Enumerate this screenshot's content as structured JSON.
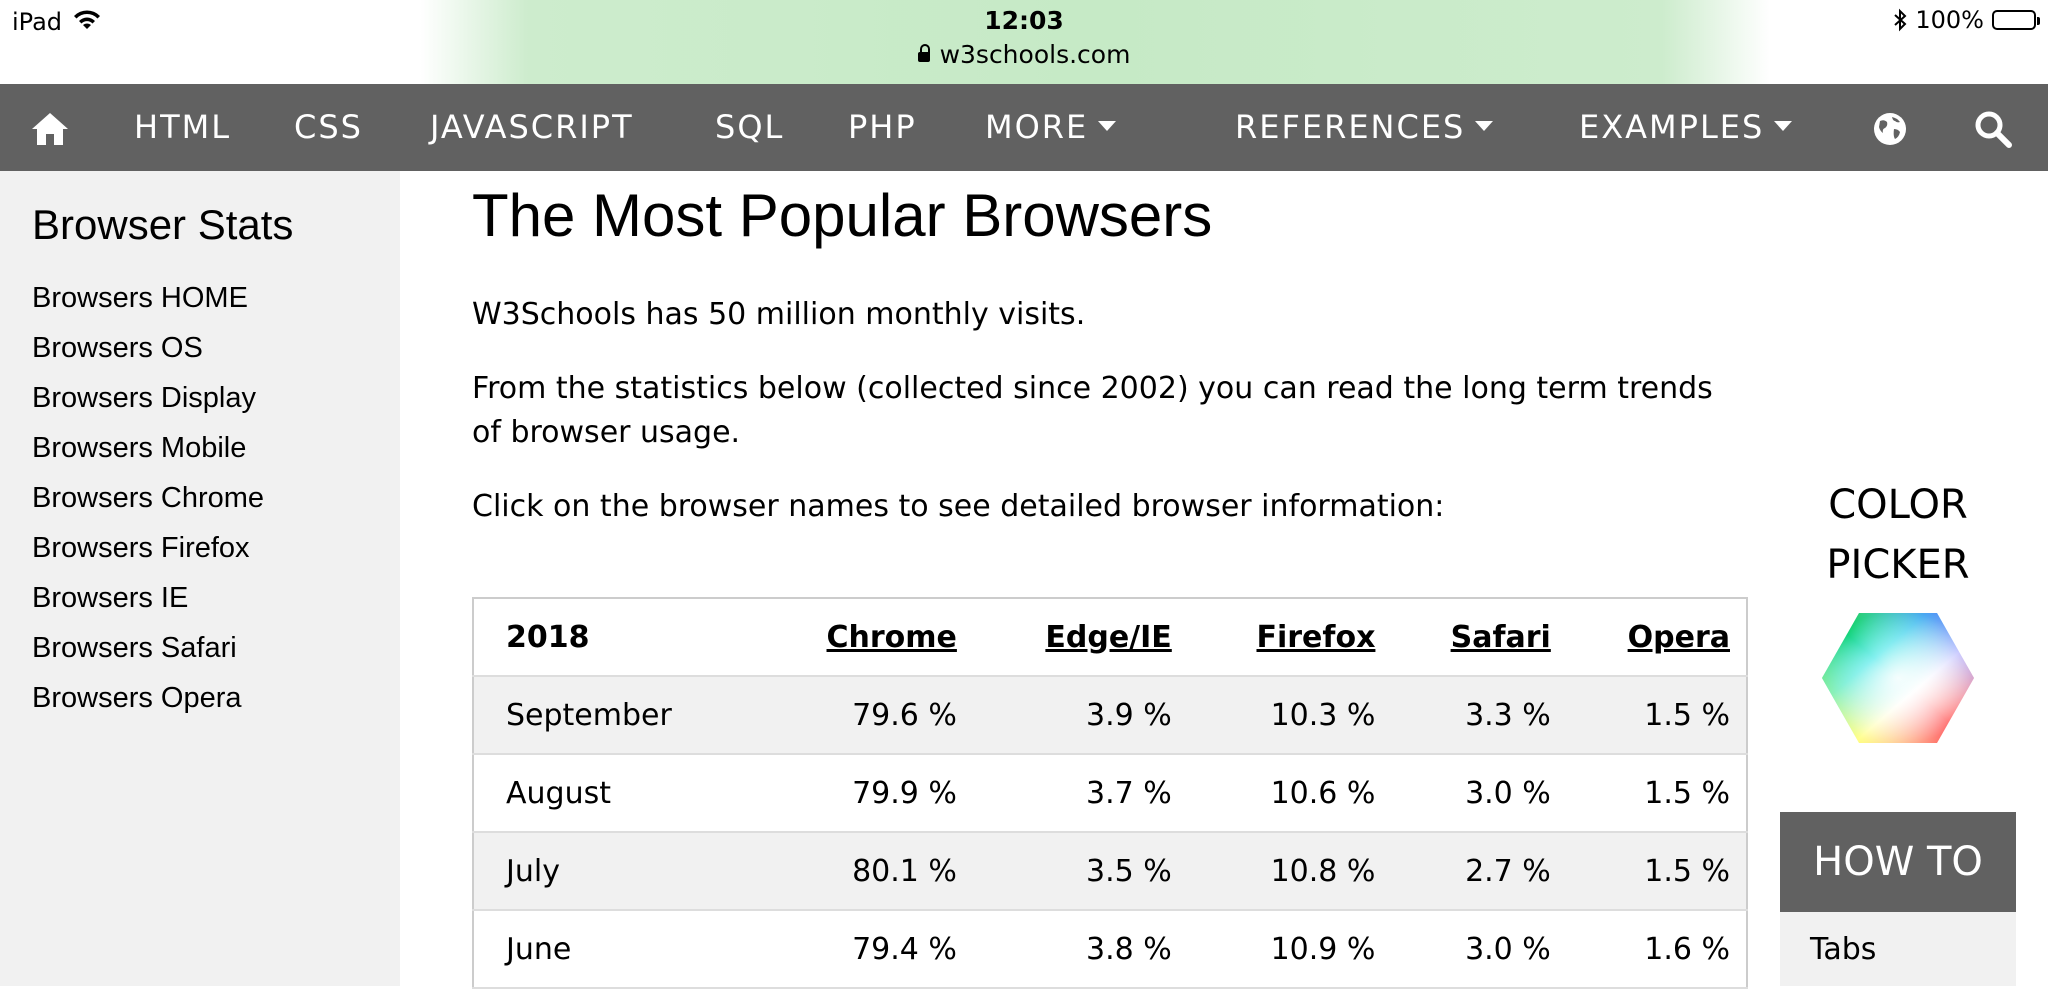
{
  "status_bar": {
    "device": "iPad",
    "time": "12:03",
    "url": "w3schools.com",
    "battery": "100%"
  },
  "nav": {
    "home_icon": "home-icon",
    "items": [
      "HTML",
      "CSS",
      "JAVASCRIPT",
      "SQL",
      "PHP",
      "MORE",
      "REFERENCES",
      "EXAMPLES"
    ],
    "globe_icon": "globe-icon",
    "search_icon": "search-icon"
  },
  "sidebar": {
    "title": "Browser Stats",
    "links": [
      "Browsers HOME",
      "Browsers OS",
      "Browsers Display",
      "Browsers Mobile",
      "Browsers Chrome",
      "Browsers Firefox",
      "Browsers IE",
      "Browsers Safari",
      "Browsers Opera"
    ]
  },
  "main": {
    "title": "The Most Popular Browsers",
    "p1": "W3Schools has 50 million monthly visits.",
    "p2": "From the statistics below (collected since 2002) you can read the long term trends of browser usage.",
    "p3": "Click on the browser names to see detailed browser information:"
  },
  "table": {
    "headers": [
      "2018",
      "Chrome",
      "Edge/IE",
      "Firefox",
      "Safari",
      "Opera"
    ],
    "rows": [
      [
        "September",
        "79.6 %",
        "3.9 %",
        "10.3 %",
        "3.3 %",
        "1.5 %"
      ],
      [
        "August",
        "79.9 %",
        "3.7 %",
        "10.6 %",
        "3.0 %",
        "1.5 %"
      ],
      [
        "July",
        "80.1 %",
        "3.5 %",
        "10.8 %",
        "2.7 %",
        "1.5 %"
      ],
      [
        "June",
        "79.4 %",
        "3.8 %",
        "10.9 %",
        "3.0 %",
        "1.6 %"
      ]
    ]
  },
  "right": {
    "color_picker_line1": "COLOR",
    "color_picker_line2": "PICKER",
    "howto": "HOW TO",
    "howto_first": "Tabs"
  },
  "colors": {
    "nav_bg": "#616161",
    "sidebar_bg": "#f1f1f1",
    "status_green": "#c6eac6"
  }
}
